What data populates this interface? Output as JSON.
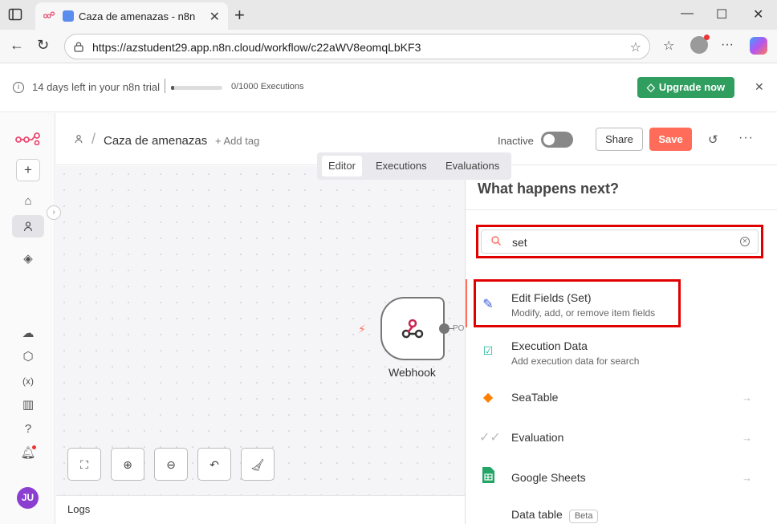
{
  "browser": {
    "tab_title": "Caza de amenazas - n8n",
    "url": "https://azstudent29.app.n8n.cloud/workflow/c22aWV8eomqLbKF3"
  },
  "trial": {
    "days_left_text": "14 days left in your n8n trial",
    "executions_text": "0/1000 Executions",
    "executions_used": 0,
    "executions_total": 1000,
    "upgrade_label": "Upgrade now"
  },
  "workflow": {
    "name": "Caza de amenazas",
    "add_tag": "+ Add tag",
    "status_label": "Inactive",
    "share_label": "Share",
    "save_label": "Save"
  },
  "view_tabs": [
    "Editor",
    "Executions",
    "Evaluations"
  ],
  "canvas": {
    "node_label": "Webhook",
    "node_output_label": "PO"
  },
  "logs_label": "Logs",
  "user_initials": "JU",
  "panel": {
    "title": "What happens next?",
    "search_value": "set",
    "items": [
      {
        "name": "Edit Fields (Set)",
        "description": "Modify, add, or remove item fields",
        "icon": "pencil-icon"
      },
      {
        "name": "Execution Data",
        "description": "Add execution data for search",
        "icon": "checklist-icon"
      },
      {
        "name": "SeaTable",
        "icon": "seatable-icon"
      },
      {
        "name": "Evaluation",
        "icon": "double-check-icon"
      },
      {
        "name": "Google Sheets",
        "icon": "google-sheets-icon"
      },
      {
        "name": "Data table",
        "badge": "Beta",
        "icon": "data-table-icon"
      }
    ]
  },
  "colors": {
    "accent": "#ff6d5a",
    "upgrade_green": "#2f9e5f",
    "highlight_red": "#e00000",
    "avatar_purple": "#8b3fd1"
  }
}
